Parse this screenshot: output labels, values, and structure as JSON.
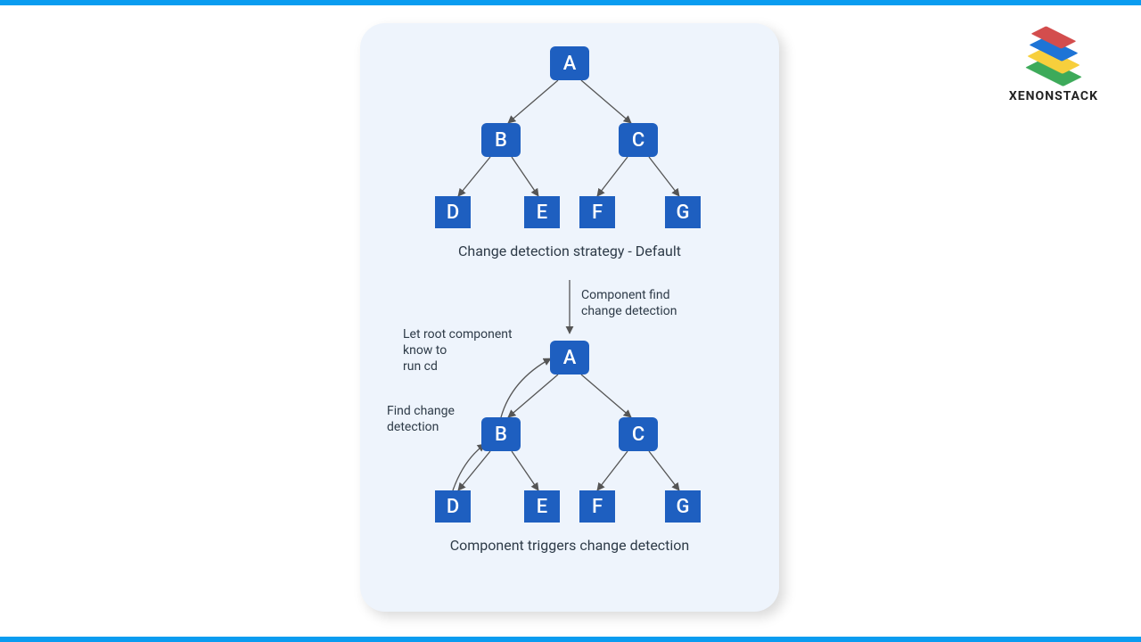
{
  "brand": {
    "name": "XENONSTACK"
  },
  "colors": {
    "node": "#1e5fc0",
    "panel": "#eef4fc",
    "bar": "#0a9cf0",
    "text": "#2e3b48"
  },
  "tree1": {
    "caption": "Change detection strategy - Default",
    "nodes": {
      "A": "A",
      "B": "B",
      "C": "C",
      "D": "D",
      "E": "E",
      "F": "F",
      "G": "G"
    }
  },
  "tree2": {
    "caption": "Component triggers change detection",
    "nodes": {
      "A": "A",
      "B": "B",
      "C": "C",
      "D": "D",
      "E": "E",
      "F": "F",
      "G": "G"
    },
    "annos": {
      "component_find": "Component find\nchange detection",
      "let_root": "Let root component\nknow to\nrun cd",
      "find_cd": "Find change\ndetection"
    }
  }
}
